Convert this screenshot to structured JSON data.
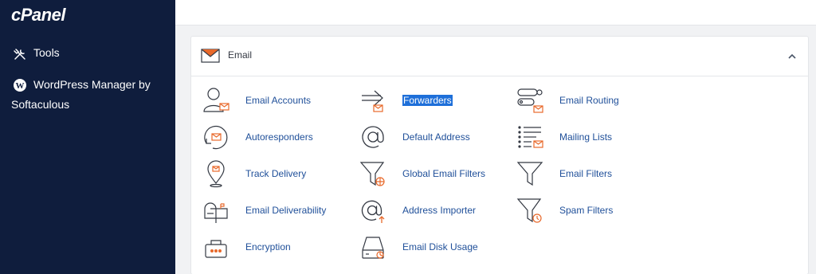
{
  "app": {
    "logo_text": "cPanel"
  },
  "sidebar": {
    "items": [
      {
        "label": "Tools",
        "icon": "tools-icon"
      },
      {
        "label_line1": "WordPress Manager by",
        "label_line2": "Softaculous",
        "icon": "wordpress-icon"
      }
    ]
  },
  "panel": {
    "title": "Email",
    "icon": "envelope-icon",
    "collapse_icon": "chevron-up-icon"
  },
  "tools": [
    {
      "label": "Email Accounts",
      "icon": "email-accounts-icon"
    },
    {
      "label": "Forwarders",
      "icon": "forwarders-icon",
      "selected": true
    },
    {
      "label": "Email Routing",
      "icon": "email-routing-icon"
    },
    {
      "label": "Autoresponders",
      "icon": "autoresponders-icon"
    },
    {
      "label": "Default Address",
      "icon": "at-sign-icon"
    },
    {
      "label": "Mailing Lists",
      "icon": "mailing-lists-icon"
    },
    {
      "label": "Track Delivery",
      "icon": "track-delivery-icon"
    },
    {
      "label": "Global Email Filters",
      "icon": "global-filter-icon"
    },
    {
      "label": "Email Filters",
      "icon": "filter-icon"
    },
    {
      "label": "Email Deliverability",
      "icon": "mailbox-icon"
    },
    {
      "label": "Address Importer",
      "icon": "address-importer-icon"
    },
    {
      "label": "Spam Filters",
      "icon": "spam-filter-icon"
    },
    {
      "label": "Encryption",
      "icon": "encryption-icon"
    },
    {
      "label": "Email Disk Usage",
      "icon": "disk-usage-icon"
    }
  ],
  "colors": {
    "sidebar_bg": "#0f1d3d",
    "accent_orange": "#e8692b",
    "link_blue": "#1f4f99",
    "selection": "#1e6fd9"
  }
}
